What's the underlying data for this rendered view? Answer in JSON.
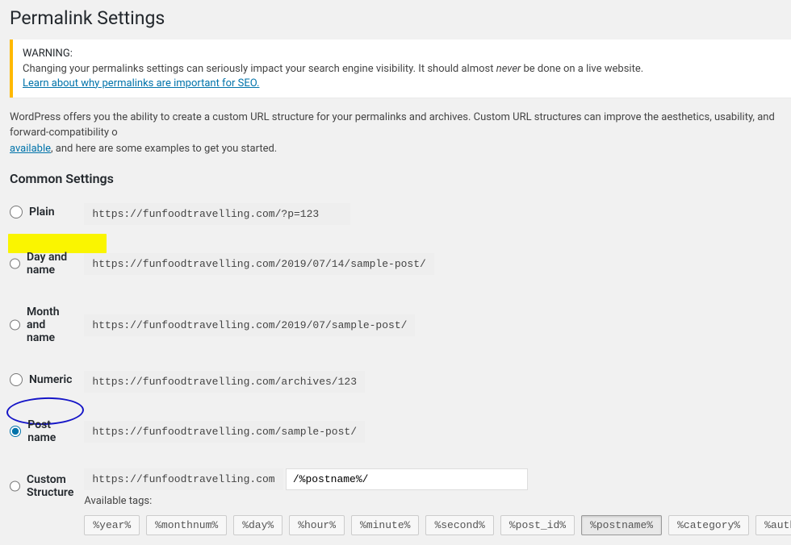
{
  "page_title": "Permalink Settings",
  "warning": {
    "label": "WARNING:",
    "text_before": "Changing your permalinks settings can seriously impact your search engine visibility. It should almost ",
    "text_italic": "never",
    "text_after": " be done on a live website.",
    "link": "Learn about why permalinks are important for SEO."
  },
  "description": {
    "text_before": "WordPress offers you the ability to create a custom URL structure for your permalinks and archives. Custom URL structures can improve the aesthetics, usability, and forward-compatibility o",
    "link": "available",
    "text_after": ", and here are some examples to get you started."
  },
  "common_settings_title": "Common Settings",
  "options": {
    "plain": {
      "label": "Plain",
      "url": "https://funfoodtravelling.com/?p=123"
    },
    "day_and_name": {
      "label": "Day and name",
      "url": "https://funfoodtravelling.com/2019/07/14/sample-post/"
    },
    "month_and_name": {
      "label": "Month and name",
      "url": "https://funfoodtravelling.com/2019/07/sample-post/"
    },
    "numeric": {
      "label": "Numeric",
      "url": "https://funfoodtravelling.com/archives/123"
    },
    "post_name": {
      "label": "Post name",
      "url": "https://funfoodtravelling.com/sample-post/"
    },
    "custom": {
      "label": "Custom Structure",
      "base": "https://funfoodtravelling.com",
      "value": "/%postname%/",
      "available_label": "Available tags:"
    }
  },
  "tags": [
    "%year%",
    "%monthnum%",
    "%day%",
    "%hour%",
    "%minute%",
    "%second%",
    "%post_id%",
    "%postname%",
    "%category%",
    "%autho"
  ],
  "selected_tag": "%postname%"
}
